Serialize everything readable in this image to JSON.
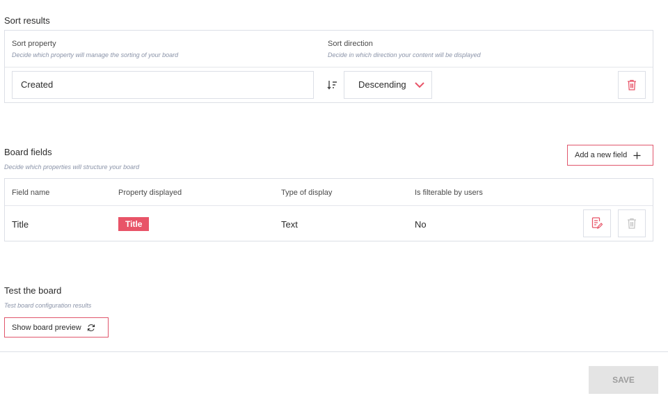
{
  "sort": {
    "title": "Sort results",
    "property_label": "Sort property",
    "property_hint": "Decide which property will manage the sorting of your board",
    "direction_label": "Sort direction",
    "direction_hint": "Decide in which direction your content will be displayed",
    "property_value": "Created",
    "direction_value": "Descending"
  },
  "fields": {
    "title": "Board fields",
    "hint": "Decide which properties will structure your board",
    "add_label": "Add a new field",
    "columns": [
      "Field name",
      "Property displayed",
      "Type of display",
      "Is filterable by users"
    ],
    "rows": [
      {
        "name": "Title",
        "property": "Title",
        "type": "Text",
        "filterable": "No"
      }
    ]
  },
  "test": {
    "title": "Test the board",
    "hint": "Test board configuration results",
    "preview_label": "Show board preview"
  },
  "footer": {
    "save_label": "SAVE"
  },
  "colors": {
    "accent": "#e85468",
    "border": "#dcdfe6",
    "hint": "#8a93a8",
    "save_bg": "#e4e4e4"
  },
  "icons": [
    "sort-descending-icon",
    "chevron-down-icon",
    "trash-icon",
    "edit-icon",
    "plus-icon",
    "refresh-icon"
  ]
}
